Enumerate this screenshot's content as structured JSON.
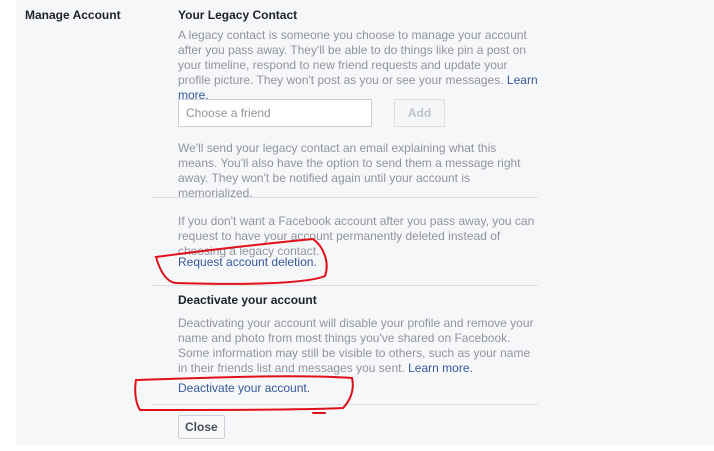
{
  "sidebar": {
    "section_label": "Manage Account"
  },
  "legacy_contact": {
    "heading": "Your Legacy Contact",
    "description": "A legacy contact is someone you choose to manage your account after you pass away. They'll be able to do things like pin a post on your timeline, respond to new friend requests and update your profile picture. They won't post as you or see your messages.",
    "learn_more": "Learn more.",
    "input_placeholder": "Choose a friend",
    "add_button": "Add",
    "notice": "We'll send your legacy contact an email explaining what this means. You'll also have the option to send them a message right away. They won't be notified again until your account is memorialized."
  },
  "deletion": {
    "description": "If you don't want a Facebook account after you pass away, you can request to have your account permanently deleted instead of choosing a legacy contact.",
    "link": "Request account deletion."
  },
  "deactivate": {
    "heading": "Deactivate your account",
    "description": "Deactivating your account will disable your profile and remove your name and photo from most things you've shared on Facebook. Some information may still be visible to others, such as your name in their friends list and messages you sent.",
    "learn_more": "Learn more.",
    "link": "Deactivate your account."
  },
  "footer": {
    "close_button": "Close"
  },
  "colors": {
    "link": "#365899",
    "muted_text": "#90949c",
    "annotation": "#e0101a",
    "panel_bg": "#f6f7f9"
  }
}
